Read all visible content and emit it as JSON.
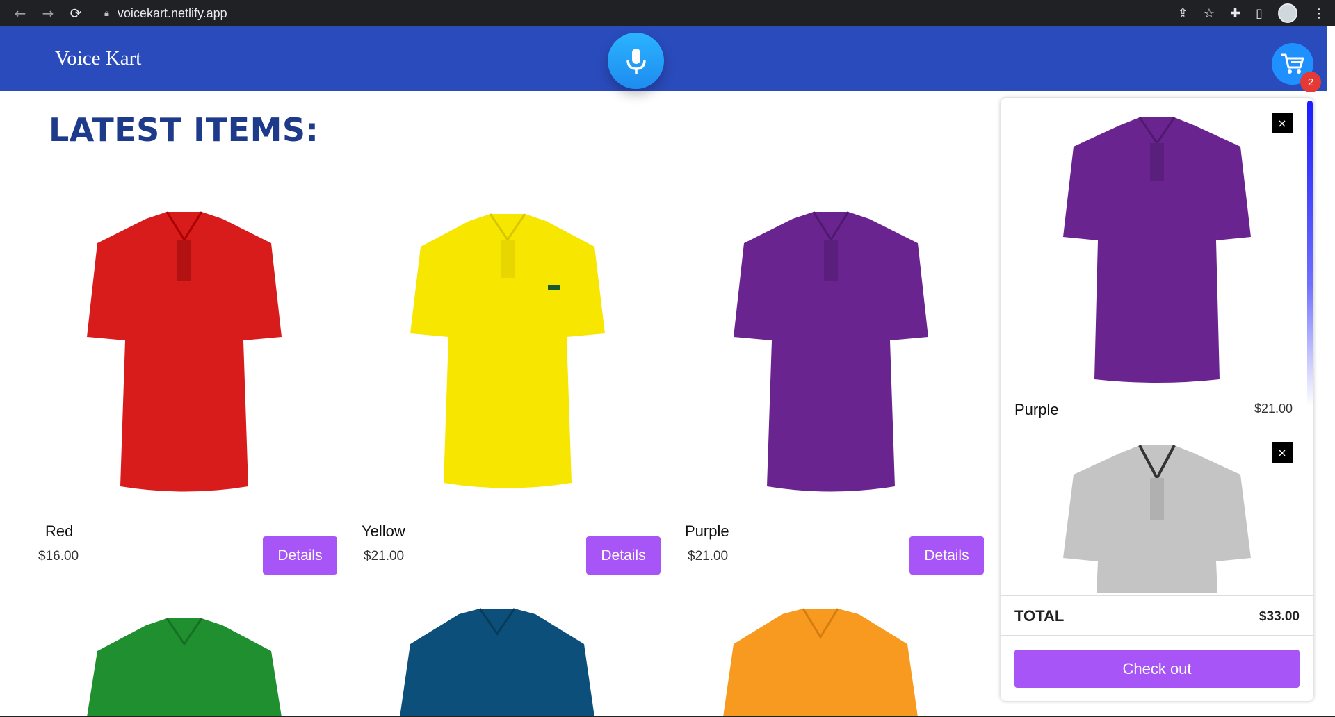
{
  "browser": {
    "url": "voicekart.netlify.app",
    "back_icon": "arrow-left-icon",
    "forward_icon": "arrow-right-icon",
    "reload_icon": "reload-icon"
  },
  "header": {
    "brand": "Voice Kart",
    "cart_count": "2",
    "colors": {
      "bar": "#2a4bbc",
      "mic": "#1e90ff",
      "badge": "#e53935"
    }
  },
  "main": {
    "heading": "LATEST ITEMS:",
    "products": [
      {
        "name": "Red",
        "price": "$16.00",
        "button": "Details",
        "color": "#d81b1b"
      },
      {
        "name": "Yellow",
        "price": "$21.00",
        "button": "Details",
        "color": "#f6e600"
      },
      {
        "name": "Purple",
        "price": "$21.00",
        "button": "Details",
        "color": "#6a2490"
      }
    ],
    "next_row_colors": [
      "#1f8f2f",
      "#0b4f7a",
      "#f79a1f"
    ]
  },
  "cart": {
    "items": [
      {
        "name": "Purple",
        "price": "$21.00",
        "color": "#6a2490"
      },
      {
        "name": "",
        "price": "",
        "color": "#c4c4c4"
      }
    ],
    "remove_label": "×",
    "total_label": "TOTAL",
    "total_value": "$33.00",
    "checkout_label": "Check out",
    "accent": "#a855f7"
  }
}
